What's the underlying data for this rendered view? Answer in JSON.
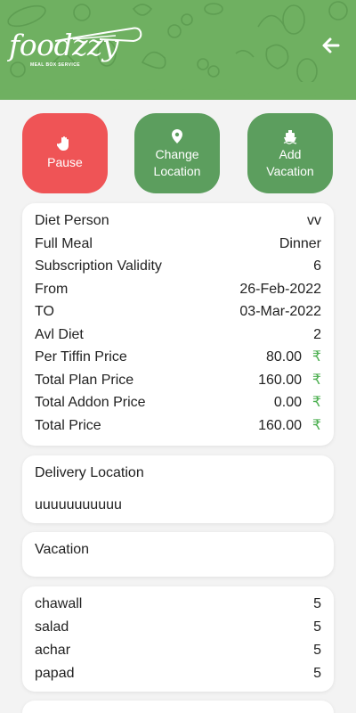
{
  "header": {
    "logo_text": "foodzzy",
    "logo_tagline": "MEAL BOX SERVICE",
    "bg_color": "#6fb061",
    "back_icon": "arrow-left-icon"
  },
  "actions": {
    "pause": {
      "label": "Pause",
      "icon": "hand-icon",
      "color": "#ef5456"
    },
    "change_location": {
      "label_line1": "Change",
      "label_line2": "Location",
      "icon": "location-pin-icon",
      "color": "#5c9e5e"
    },
    "add_vacation": {
      "label_line1": "Add",
      "label_line2": "Vacation",
      "icon": "ship-icon",
      "color": "#5c9e5e"
    }
  },
  "details": {
    "diet_person": {
      "label": "Diet Person",
      "value": "vv"
    },
    "full_meal": {
      "label": "Full Meal",
      "value": "Dinner"
    },
    "validity": {
      "label": "Subscription Validity",
      "value": "6"
    },
    "from": {
      "label": "From",
      "value": "26-Feb-2022"
    },
    "to": {
      "label": "TO",
      "value": "03-Mar-2022"
    },
    "avl_diet": {
      "label": "Avl Diet",
      "value": "2"
    },
    "per_tiffin": {
      "label": "Per Tiffin Price",
      "value": "80.00"
    },
    "total_plan": {
      "label": "Total Plan Price",
      "value": "160.00"
    },
    "total_addon": {
      "label": "Total Addon Price",
      "value": "0.00"
    },
    "total": {
      "label": "Total Price",
      "value": "160.00"
    },
    "currency_symbol": "₹"
  },
  "delivery": {
    "title": "Delivery Location",
    "address": "uuuuuuuuuuu"
  },
  "vacation": {
    "title": "Vacation"
  },
  "addons": {
    "items": [
      {
        "name": "chawall",
        "qty": "5"
      },
      {
        "name": "salad",
        "qty": "5"
      },
      {
        "name": "achar",
        "qty": "5"
      },
      {
        "name": "papad",
        "qty": "5"
      }
    ]
  }
}
